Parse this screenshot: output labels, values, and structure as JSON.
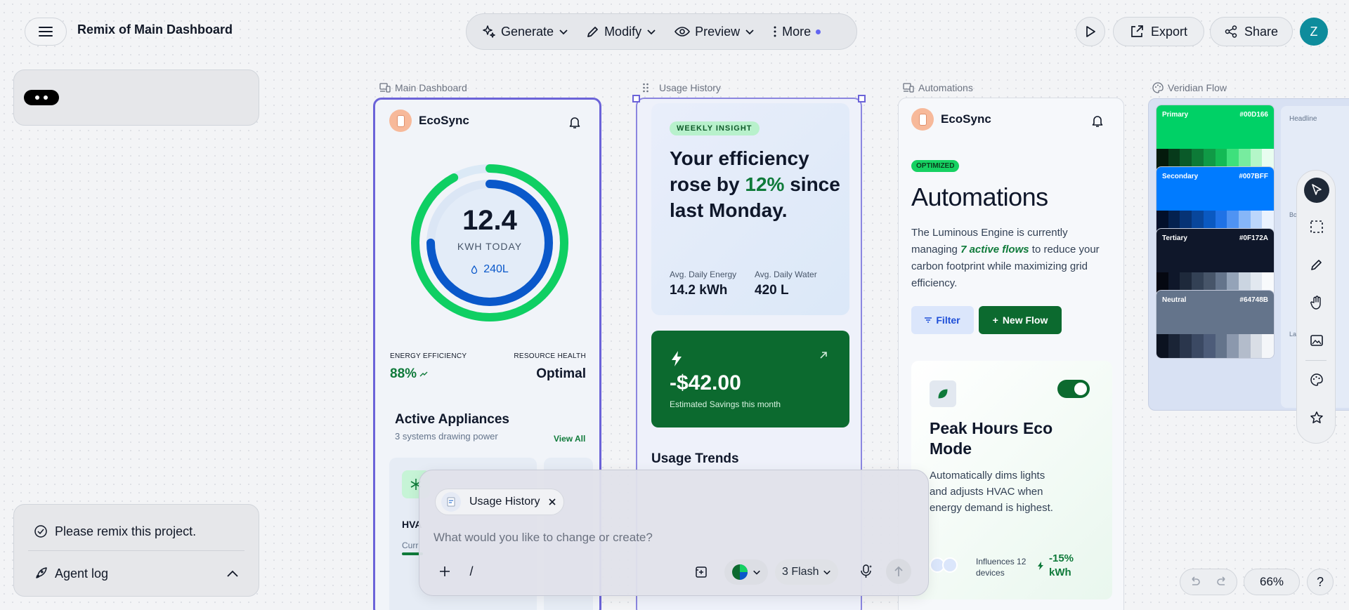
{
  "header": {
    "project_title": "Remix of Main Dashboard",
    "toolbar": {
      "generate": "Generate",
      "modify": "Modify",
      "preview": "Preview",
      "more": "More"
    },
    "export": "Export",
    "share": "Share",
    "avatar_initial": "Z"
  },
  "left_panel": {
    "prompt_text": "Please remix this project.",
    "agent_log": "Agent log"
  },
  "frames": {
    "main": "Main Dashboard",
    "usage": "Usage History",
    "automations": "Automations",
    "veridian": "Veridian Flow"
  },
  "main_dashboard": {
    "brand": "EcoSync",
    "energy_value": "12.4",
    "energy_label": "KWH TODAY",
    "water_value": "240L",
    "efficiency_label": "ENERGY EFFICIENCY",
    "efficiency_value": "88%",
    "health_label": "RESOURCE HEALTH",
    "health_value": "Optimal",
    "appliances_title": "Active Appliances",
    "appliances_sub": "3 systems drawing power",
    "view_all": "View All",
    "appliance_name": "HVA",
    "appliance_sub": "Curr",
    "outer_ring_pct": 92,
    "inner_ring_pct": 75
  },
  "usage_history": {
    "badge": "WEEKLY INSIGHT",
    "headline_a": "Your efficiency rose by ",
    "headline_pct": "12%",
    "headline_b": " since last Monday.",
    "energy_label": "Avg. Daily Energy",
    "energy_value": "14.2 kWh",
    "water_label": "Avg. Daily Water",
    "water_value": "420 L",
    "savings_value": "-$42.00",
    "savings_label": "Estimated Savings this month",
    "trends_title": "Usage Trends"
  },
  "automations": {
    "brand": "EcoSync",
    "badge": "OPTIMIZED",
    "title": "Automations",
    "desc_a": "The Luminous Engine is currently managing ",
    "desc_em": "7 active flows",
    "desc_b": " to reduce your carbon footprint while maximizing grid efficiency.",
    "filter": "Filter",
    "new_flow": "New Flow",
    "flow_title": "Peak Hours Eco Mode",
    "flow_desc": "Automatically dims lights and adjusts HVAC when energy demand is highest.",
    "influences": "Influences 12 devices",
    "impact": "-15% kWh",
    "toggle_on": true
  },
  "veridian": {
    "swatches": [
      {
        "name": "Primary",
        "hex": "#00D166",
        "color": "#00D166",
        "strip": [
          "#041a0c",
          "#073a1b",
          "#0a5a29",
          "#0d7a37",
          "#109a46",
          "#13ba55",
          "#3ee07c",
          "#77ec9f",
          "#b4f6c8",
          "#e9fdf0"
        ]
      },
      {
        "name": "Secondary",
        "hex": "#007BFF",
        "color": "#007BFF",
        "strip": [
          "#020f2a",
          "#04214f",
          "#063375",
          "#08469b",
          "#0a59c1",
          "#1f72e6",
          "#4f93f3",
          "#86b6f8",
          "#bcd6fb",
          "#eaf2fe"
        ]
      },
      {
        "name": "Tertiary",
        "hex": "#0F172A",
        "color": "#0F172A",
        "strip": [
          "#050811",
          "#0f172a",
          "#1e293b",
          "#334155",
          "#475569",
          "#64748b",
          "#94a3b8",
          "#cbd5e1",
          "#e2e8f0",
          "#f8fafc"
        ]
      },
      {
        "name": "Neutral",
        "hex": "#64748B",
        "color": "#64748B",
        "strip": [
          "#0b1220",
          "#1a2436",
          "#2a364c",
          "#3b4963",
          "#4d5c79",
          "#64748b",
          "#8b98ad",
          "#b3bccb",
          "#d9dee6",
          "#f4f6f9"
        ]
      }
    ],
    "side_labels": [
      "Headline",
      "Bo",
      "La"
    ]
  },
  "chat": {
    "chip_label": "Usage History",
    "placeholder": "What would you like to change or create?",
    "slash": "/",
    "model": "3 Flash"
  },
  "zoom": "66%",
  "help": "?",
  "colors": {
    "accent": "#6b63d8",
    "green": "#0c6a2f",
    "blue": "#0a58ca"
  }
}
